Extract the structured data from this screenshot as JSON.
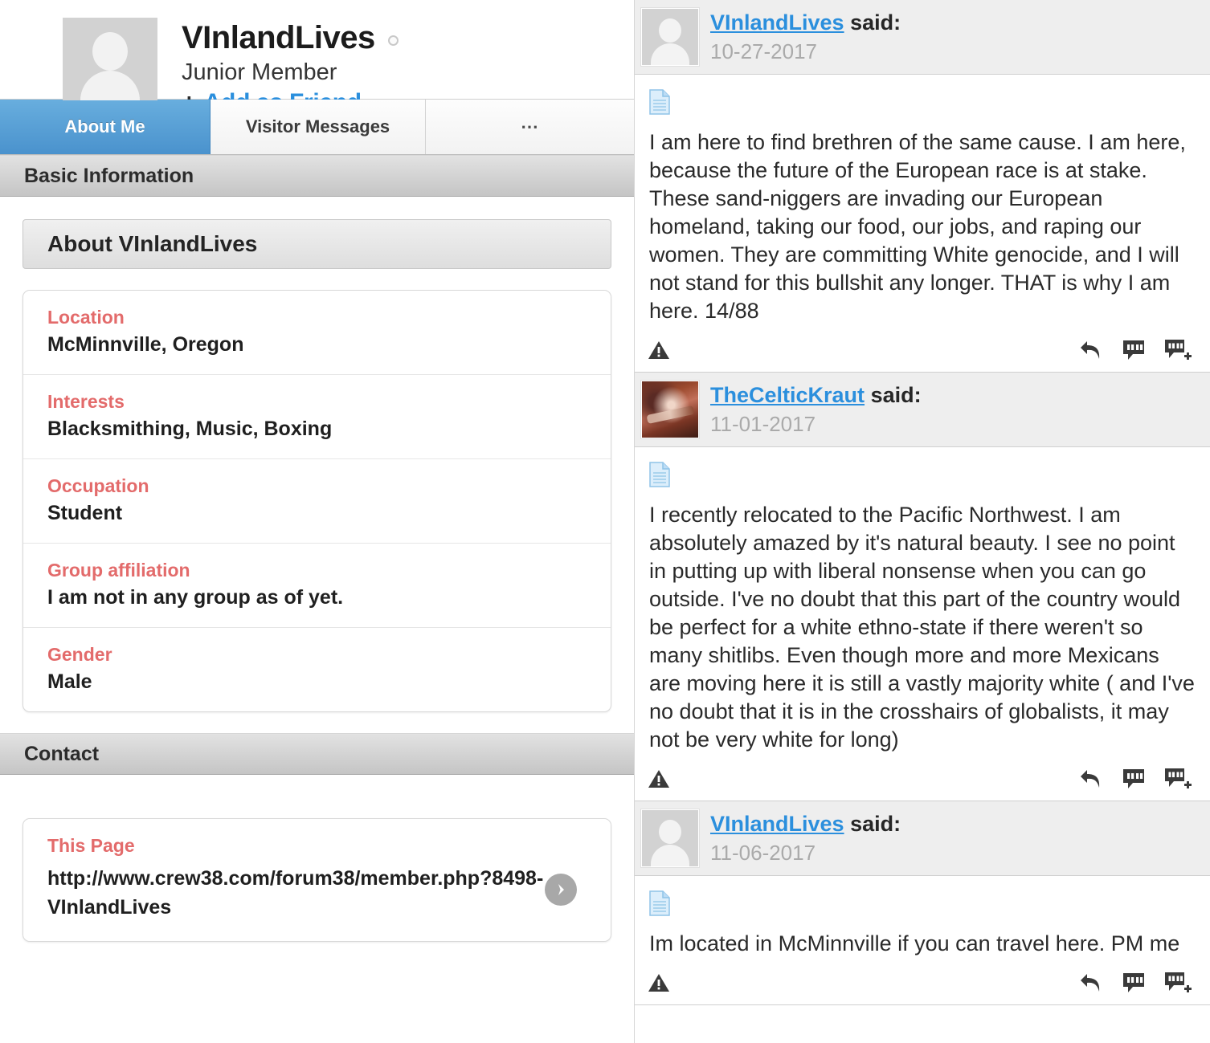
{
  "profile": {
    "username": "VInlandLives",
    "rank": "Junior Member",
    "add_friend_label": "Add as Friend",
    "plus_symbol": "+",
    "status_icon": "offline-status-circle-icon",
    "avatar_icon": "default-avatar-icon"
  },
  "tabs": [
    {
      "label": "About Me",
      "active": true
    },
    {
      "label": "Visitor Messages",
      "active": false
    },
    {
      "label": "…",
      "active": false
    }
  ],
  "sections": {
    "basic_information": {
      "header": "Basic Information",
      "about_card_title": "About VInlandLives",
      "fields": [
        {
          "label": "Location",
          "value": "McMinnville, Oregon"
        },
        {
          "label": "Interests",
          "value": "Blacksmithing, Music, Boxing"
        },
        {
          "label": "Occupation",
          "value": "Student"
        },
        {
          "label": "Group affiliation",
          "value": "I am not in any group as of yet."
        },
        {
          "label": "Gender",
          "value": "Male"
        }
      ]
    },
    "contact": {
      "header": "Contact",
      "label": "This Page",
      "url": "http://www.crew38.com/forum38/member.php?8498-VInlandLives",
      "disclosure_icon": "chevron-right-icon"
    }
  },
  "posts": [
    {
      "author": "VInlandLives",
      "said_suffix": "said:",
      "date": "10-27-2017",
      "avatar_type": "default",
      "body": "I am here to find brethren of the same cause. I am here, because the future of the European race is at stake. These sand-niggers are invading our European homeland, taking our food, our jobs, and raping our women. They are committing White genocide, and I will not stand for this bullshit any longer. THAT is why I am here. 14/88",
      "icons": {
        "document": "document-icon",
        "report": "report-warning-icon",
        "reply": "reply-arrow-icon",
        "quote": "quote-icon",
        "multiquote": "multi-quote-add-icon"
      }
    },
    {
      "author": "TheCelticKraut",
      "said_suffix": "said:",
      "date": "11-01-2017",
      "avatar_type": "photo",
      "body": "I recently relocated to the Pacific Northwest. I am absolutely amazed by it's natural beauty. I see no point in putting up with liberal nonsense when you can go outside. I've no doubt that this part of the country would be perfect for a white ethno-state if there weren't so many shitlibs. Even though more and more Mexicans are moving here it is still a vastly majority white ( and I've no doubt that it is in the crosshairs of globalists, it may not be very white for long)",
      "icons": {
        "document": "document-icon",
        "report": "report-warning-icon",
        "reply": "reply-arrow-icon",
        "quote": "quote-icon",
        "multiquote": "multi-quote-add-icon"
      }
    },
    {
      "author": "VInlandLives",
      "said_suffix": "said:",
      "date": "11-06-2017",
      "avatar_type": "default",
      "body": "Im located in McMinnville if you can travel here. PM me",
      "icons": {
        "document": "document-icon",
        "report": "report-warning-icon",
        "reply": "reply-arrow-icon",
        "quote": "quote-icon",
        "multiquote": "multi-quote-add-icon"
      }
    }
  ],
  "colors": {
    "accent_blue": "#2b8fdd",
    "label_red": "#e36b6b",
    "tab_active": "#4a92cd"
  }
}
